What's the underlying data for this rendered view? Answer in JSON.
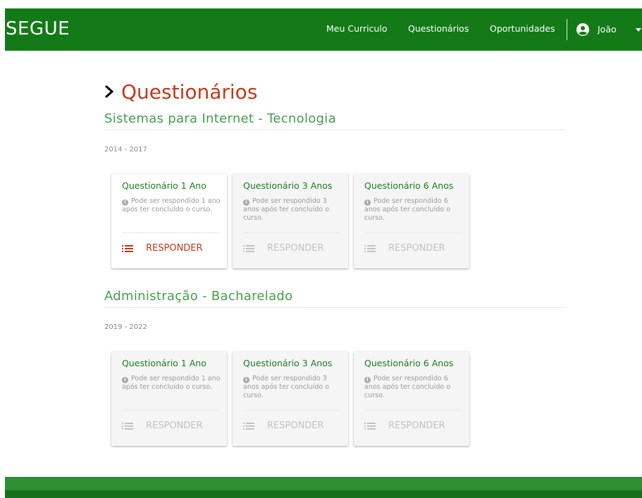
{
  "brand": "SEGUE",
  "nav": {
    "curriculum": "Meu Curriculo",
    "questionnaires": "Questionários",
    "opportunities": "Oportunidades",
    "user_name": "João"
  },
  "page": {
    "title": "Questionários"
  },
  "colors": {
    "nav_bg": "#137a17",
    "title": "#c2381b",
    "course_title": "#43a047",
    "card_title": "#1b7d1f",
    "footer": "#2f8f33"
  },
  "courses": [
    {
      "title": "Sistemas para Internet - Tecnologia",
      "period": "2014 - 2017",
      "cards": [
        {
          "title": "Questionário 1 Ano",
          "desc": "Pode ser respondido 1 ano após ter concluído o curso.",
          "action": "RESPONDER",
          "enabled": true
        },
        {
          "title": "Questionário 3 Anos",
          "desc": "Pode ser respondido 3 anos após ter concluído o curso.",
          "action": "RESPONDER",
          "enabled": false
        },
        {
          "title": "Questionário 6 Anos",
          "desc": "Pode ser respondido 6 anos após ter concluído o curso.",
          "action": "RESPONDER",
          "enabled": false
        }
      ]
    },
    {
      "title": "Administração - Bacharelado",
      "period": "2019 - 2022",
      "cards": [
        {
          "title": "Questionário 1 Ano",
          "desc": "Pode ser respondido 1 ano após ter concluído o curso.",
          "action": "RESPONDER",
          "enabled": false
        },
        {
          "title": "Questionário 3 Anos",
          "desc": "Pode ser respondido 3 anos após ter concluído o curso.",
          "action": "RESPONDER",
          "enabled": false
        },
        {
          "title": "Questionário 6 Anos",
          "desc": "Pode ser respondido 6 anos após ter concluído o curso.",
          "action": "RESPONDER",
          "enabled": false
        }
      ]
    }
  ]
}
